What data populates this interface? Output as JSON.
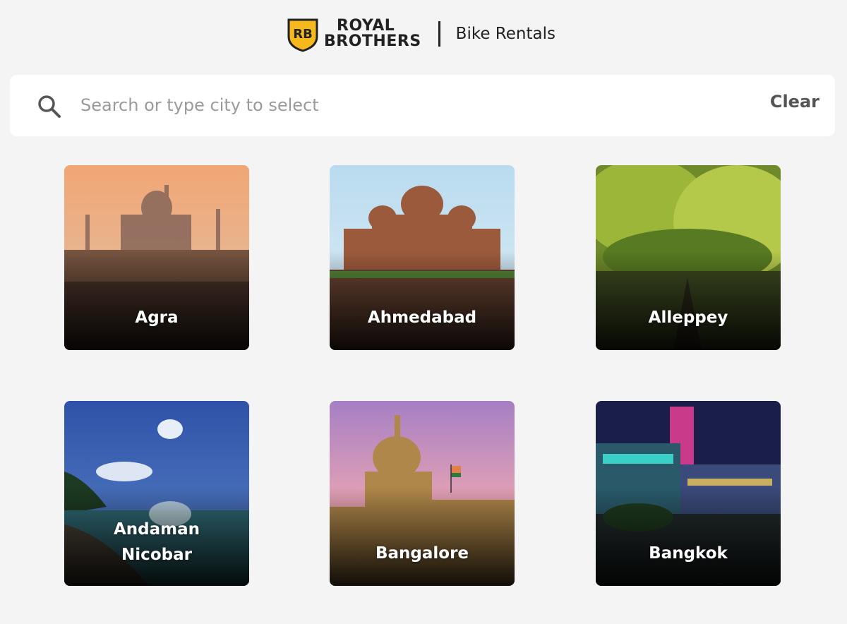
{
  "header": {
    "brand_line1": "ROYAL",
    "brand_line2": "BROTHERS",
    "badge_text": "RB",
    "tagline": "Bike Rentals",
    "brand_color": "#f5b91e"
  },
  "search": {
    "placeholder": "Search or type city to select",
    "value": "",
    "clear_label": "Clear",
    "icon": "search-icon"
  },
  "cities": [
    {
      "name": "Agra"
    },
    {
      "name": "Ahmedabad"
    },
    {
      "name": "Alleppey"
    },
    {
      "name_line1": "Andaman",
      "name_line2": "Nicobar"
    },
    {
      "name": "Bangalore"
    },
    {
      "name": "Bangkok"
    }
  ]
}
